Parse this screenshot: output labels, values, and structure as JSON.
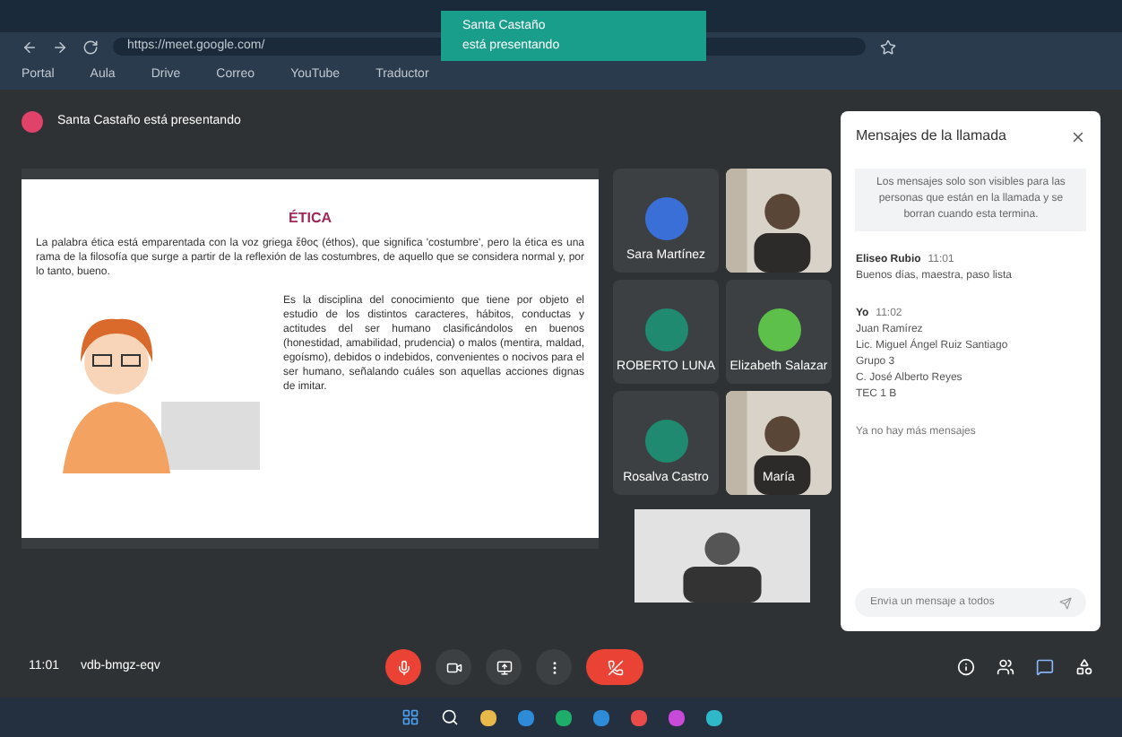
{
  "toast": {
    "title": "Santa Castaño",
    "subtitle": "está presentando"
  },
  "address": "https://meet.google.com/",
  "bookmarks": [
    "Portal",
    "Aula",
    "Drive",
    "Correo",
    "YouTube",
    "Traductor"
  ],
  "presenter_notice": "Santa Castaño está presentando",
  "slide": {
    "title": "ÉTICA",
    "paragraph": "La palabra ética está emparentada con la voz griega ἔθος (éthos), que significa 'costumbre', pero la ética es una rama de la filosofía que surge a partir de la reflexión de las costumbres, de aquello que se considera normal y, por lo tanto, bueno.",
    "definition": "Es la disciplina del conocimiento que tiene por objeto el estudio de los distintos caracteres, hábitos, conductas y actitudes del ser humano clasificándolos en buenos (honestidad, amabilidad, prudencia) o malos (mentira, maldad, egoísmo), debidos o indebidos, convenientes o nocivos para el ser humano, señalando cuáles son aquellas acciones dignas de imitar."
  },
  "participants": [
    {
      "name": "Sara Martínez",
      "kind": "avatar",
      "color": "#3b6fd8"
    },
    {
      "kind": "video"
    },
    {
      "name": "ROBERTO LUNA",
      "kind": "avatar",
      "color": "#1f8a70"
    },
    {
      "name": "Elizabeth Salazar",
      "kind": "avatar",
      "color": "#5cc04a"
    },
    {
      "name": "Rosalva Castro",
      "kind": "avatar",
      "color": "#1f8a70"
    },
    {
      "name": "María",
      "kind": "video"
    }
  ],
  "chat": {
    "title": "Mensajes de la llamada",
    "notice": "Los mensajes solo son visibles para las personas que están en la llamada y se borran cuando esta termina.",
    "messages": [
      {
        "sender": "Eliseo Rubio",
        "time": "11:01",
        "lines": [
          "Buenos días, maestra, paso lista"
        ]
      },
      {
        "sender": "Yo",
        "time": "11:02",
        "lines": [
          "Juan Ramírez",
          "Lic. Miguel Ángel Ruiz Santiago",
          "Grupo 3",
          "C. José Alberto Reyes",
          "TEC 1 B"
        ]
      }
    ],
    "footer": "Ya no hay más mensajes",
    "placeholder": "Envía un mensaje a todos"
  },
  "meeting": {
    "time": "11:01",
    "code": "vdb-bmgz-eqv"
  }
}
